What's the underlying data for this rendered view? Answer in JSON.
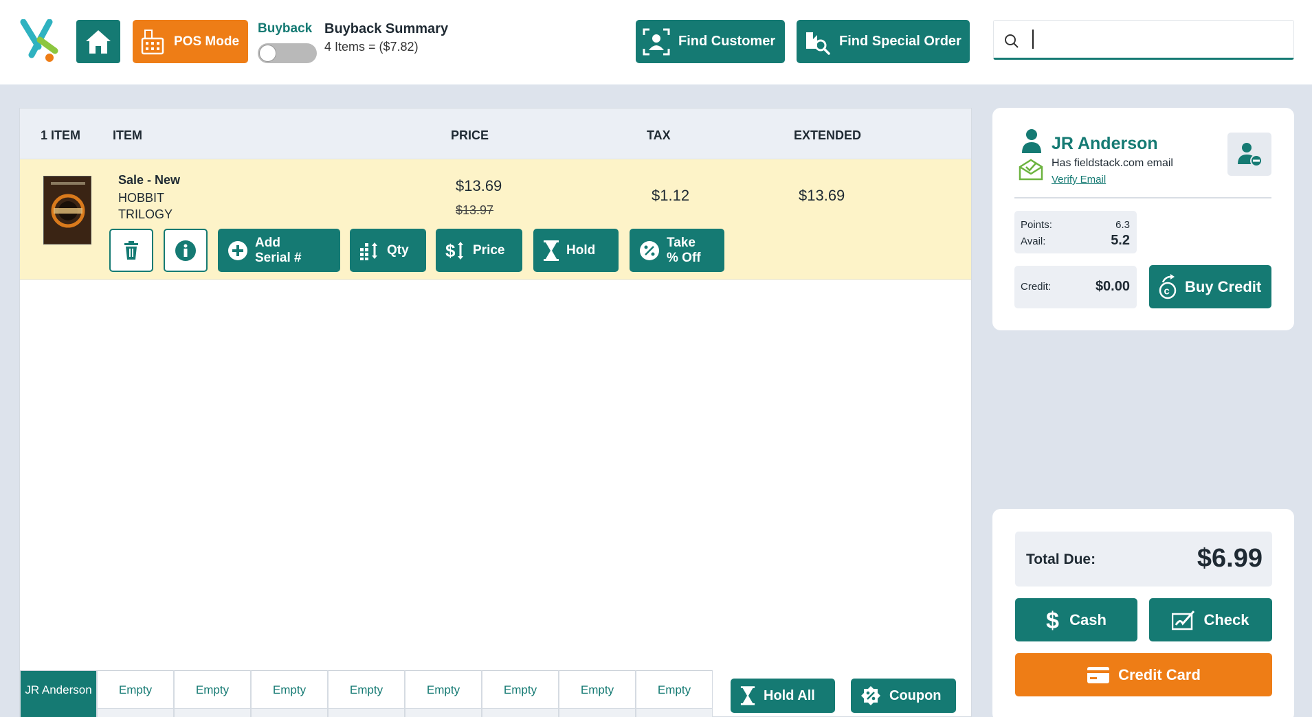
{
  "header": {
    "pos_mode_label": "POS Mode",
    "buyback_label": "Buyback",
    "buyback_summary_title": "Buyback Summary",
    "buyback_summary_detail": "4 Items = ($7.82)",
    "find_customer_label": "Find Customer",
    "find_special_order_label": "Find Special Order",
    "search_value": ""
  },
  "cart": {
    "columns": {
      "count": "1 ITEM",
      "item": "ITEM",
      "price": "PRICE",
      "tax": "TAX",
      "extended": "EXTENDED"
    },
    "items": [
      {
        "type": "Sale - New",
        "name": "HOBBIT TRILOGY",
        "price": "$13.69",
        "original_price": "$13.97",
        "tax": "$1.12",
        "extended": "$13.69",
        "actions": {
          "add_serial": "Add Serial #",
          "qty": "Qty",
          "price": "Price",
          "hold": "Hold",
          "take_off": "Take % Off"
        }
      }
    ],
    "tabs": [
      "JR Anderson",
      "Empty",
      "Empty",
      "Empty",
      "Empty",
      "Empty",
      "Empty",
      "Empty",
      "Empty"
    ],
    "hold_all_label": "Hold All",
    "coupon_label": "Coupon"
  },
  "customer": {
    "name": "JR Anderson",
    "email_status": "Has fieldstack.com email",
    "verify_label": "Verify Email",
    "points_label": "Points:",
    "points_value": "6.3",
    "avail_label": "Avail:",
    "avail_value": "5.2",
    "credit_label": "Credit:",
    "credit_value": "$0.00",
    "buy_credit_label": "Buy Credit"
  },
  "payment": {
    "total_label": "Total Due:",
    "total_value": "$6.99",
    "cash_label": "Cash",
    "check_label": "Check",
    "credit_card_label": "Credit Card"
  },
  "colors": {
    "brand_teal": "#157a73",
    "accent_orange": "#ee7d16",
    "row_highlight": "#fdf3c8"
  }
}
